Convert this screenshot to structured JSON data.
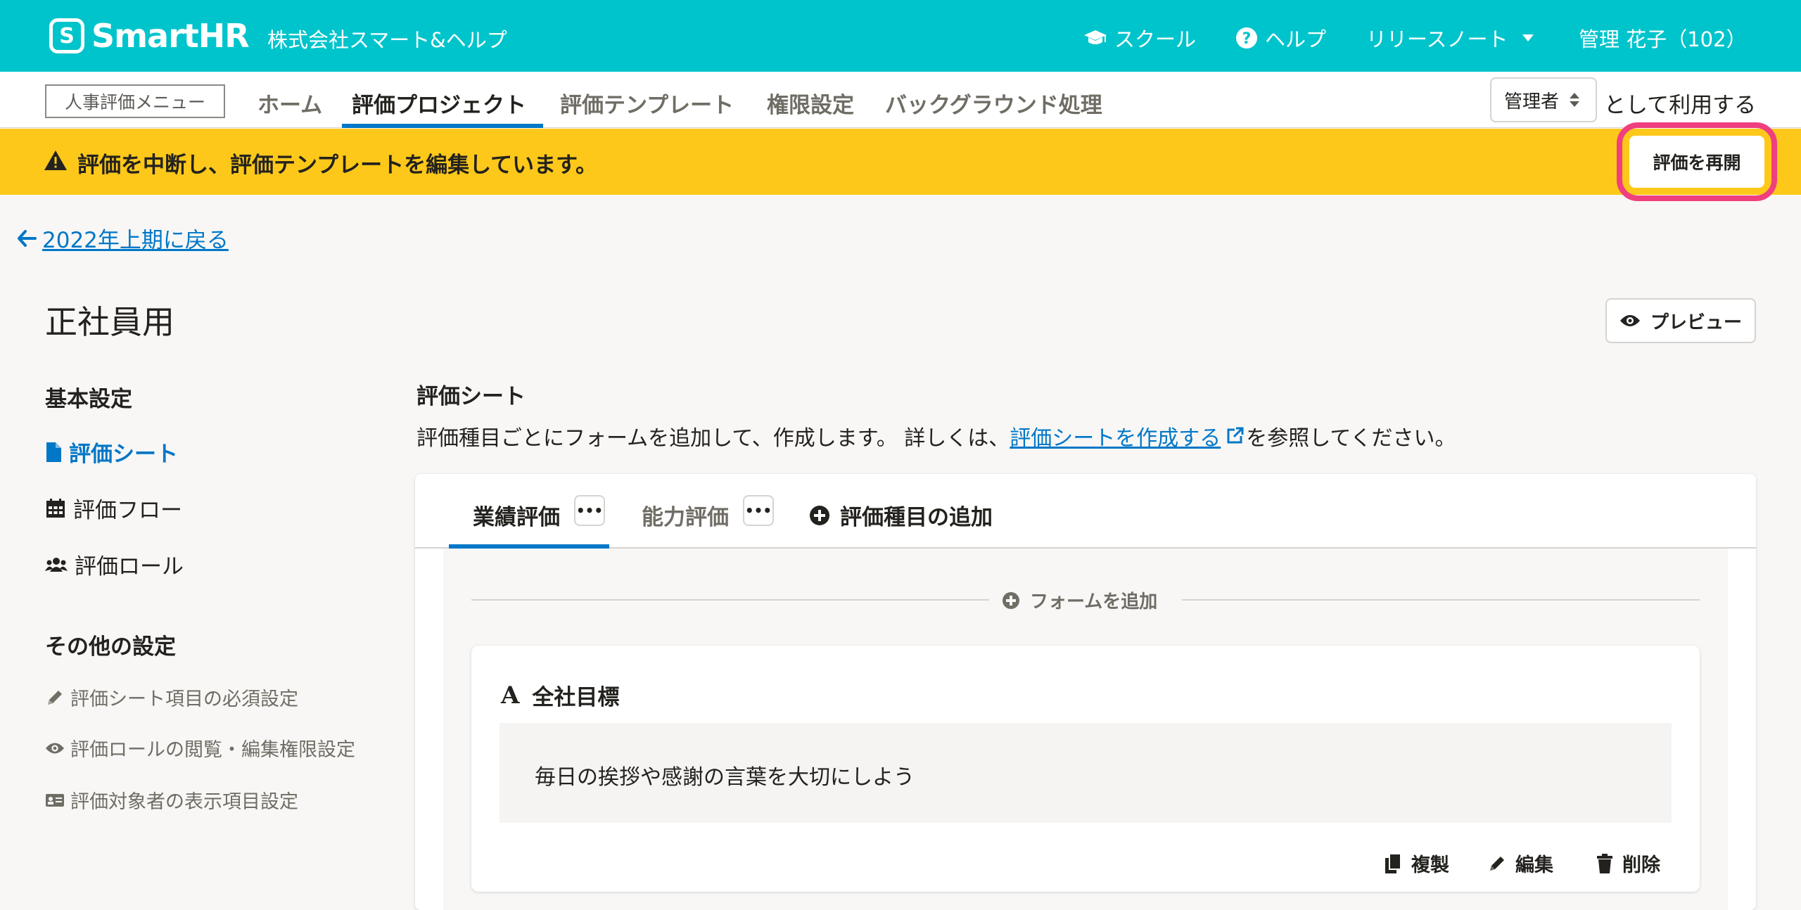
{
  "header": {
    "logo_mark": "S",
    "logo_text": "SmartHR",
    "company": "株式会社スマート&ヘルプ",
    "nav": {
      "school": "スクール",
      "help": "ヘルプ",
      "release_notes": "リリースノート",
      "user": "管理 花子（102）"
    }
  },
  "subnav": {
    "menu_label": "人事評価メニュー",
    "tabs": [
      "ホーム",
      "評価プロジェクト",
      "評価テンプレート",
      "権限設定",
      "バックグラウンド処理"
    ],
    "active_tab": "評価プロジェクト",
    "role_select": "管理者",
    "role_suffix": "として利用する"
  },
  "banner": {
    "message": "評価を中断し、評価テンプレートを編集しています。",
    "button": "評価を再開",
    "color": "#fec81a",
    "highlight_color": "#ef3f7f"
  },
  "page": {
    "back_link": "2022年上期に戻る",
    "title": "正社員用",
    "preview_button": "プレビュー"
  },
  "sidebar": {
    "basic_heading": "基本設定",
    "basic_items": [
      "評価シート",
      "評価フロー",
      "評価ロール"
    ],
    "other_heading": "その他の設定",
    "other_items": [
      "評価シート項目の必須設定",
      "評価ロールの閲覧・編集権限設定",
      "評価対象者の表示項目設定"
    ]
  },
  "main": {
    "section_title": "評価シート",
    "desc_prefix": "評価種目ごとにフォームを追加して、作成します。 詳しくは、",
    "desc_link": "評価シートを作成する",
    "desc_suffix": "を参照してください。",
    "tabs": [
      "業績評価",
      "能力評価"
    ],
    "add_category": "評価種目の追加",
    "more": "•••",
    "add_form": "フォームを追加",
    "form": {
      "type_letter": "A",
      "title": "全社目標",
      "text": "毎日の挨拶や感謝の言葉を大切にしよう",
      "actions": [
        "複製",
        "編集",
        "削除"
      ]
    }
  },
  "colors": {
    "brand": "#00c4cc",
    "link": "#0077c7"
  }
}
